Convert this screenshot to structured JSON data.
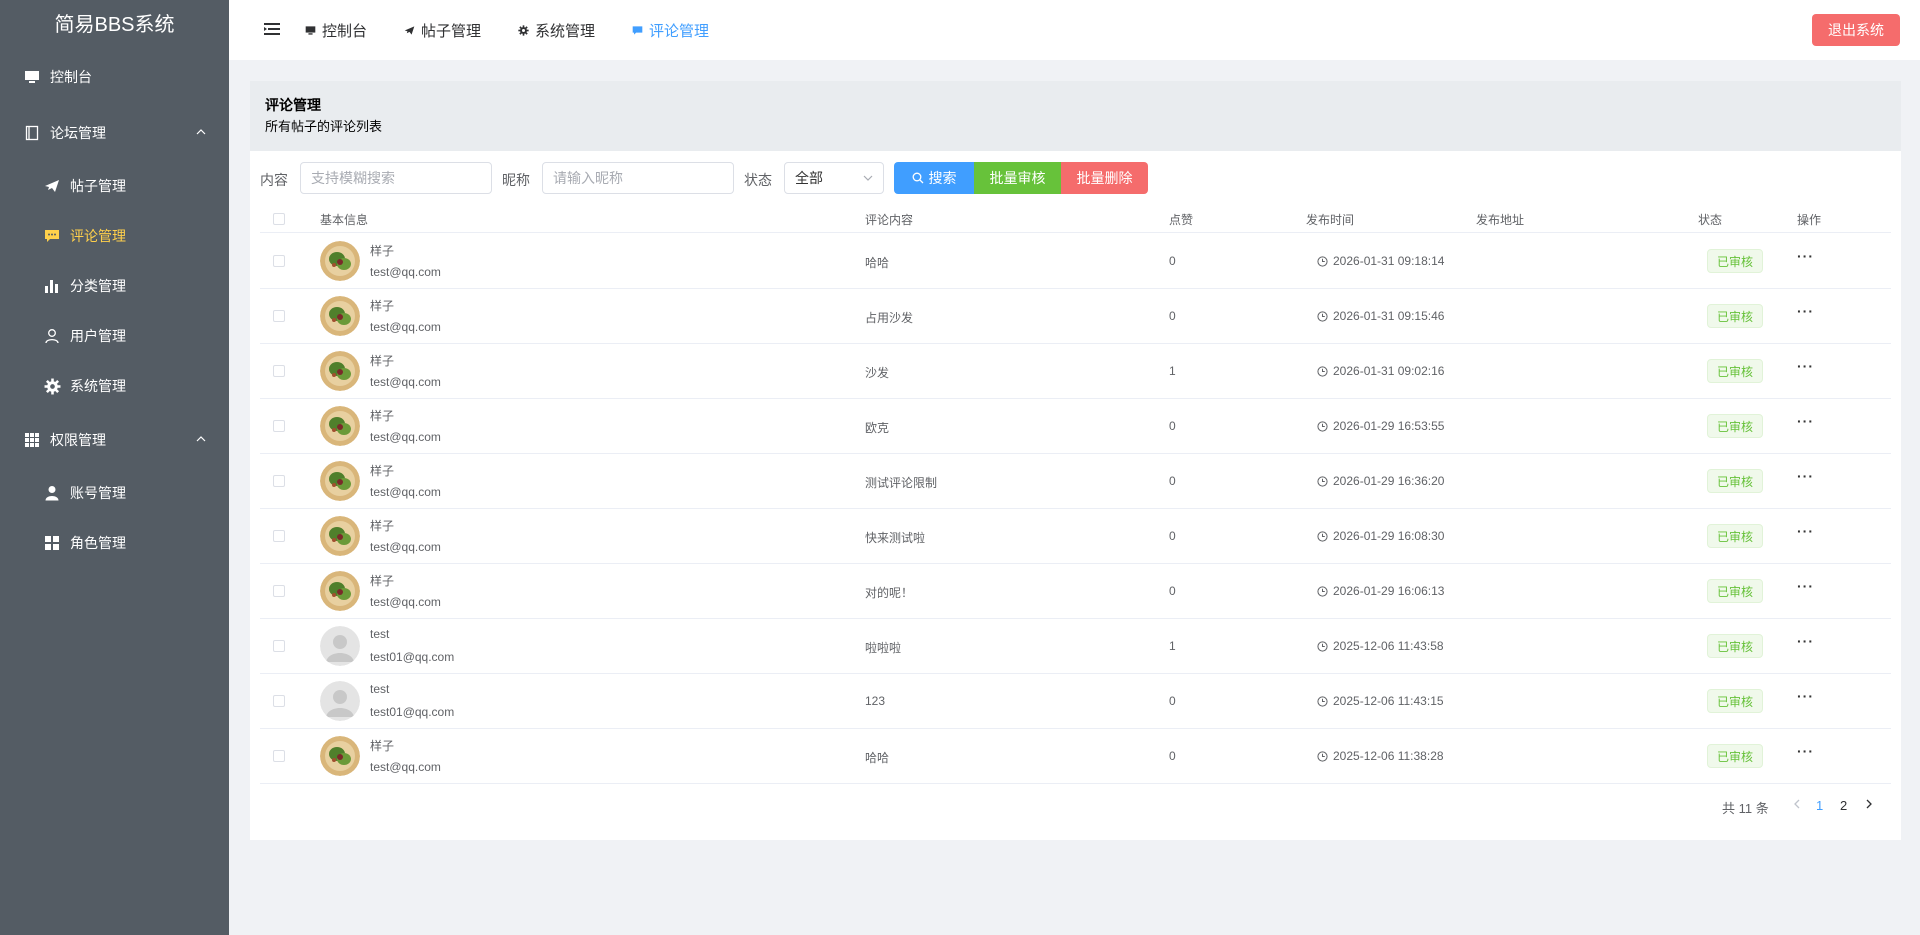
{
  "app": {
    "title": "简易BBS系统"
  },
  "sidebar": {
    "items": [
      {
        "label": "控制台",
        "icon": "monitor-icon"
      },
      {
        "label": "论坛管理",
        "icon": "notebook-icon"
      },
      {
        "label": "帖子管理",
        "icon": "send-icon"
      },
      {
        "label": "评论管理",
        "icon": "chat-icon",
        "active": true
      },
      {
        "label": "分类管理",
        "icon": "bar-chart-icon"
      },
      {
        "label": "用户管理",
        "icon": "user-icon"
      },
      {
        "label": "系统管理",
        "icon": "gear-icon"
      },
      {
        "label": "权限管理",
        "icon": "grid-icon"
      },
      {
        "label": "账号管理",
        "icon": "user-filled-icon"
      },
      {
        "label": "角色管理",
        "icon": "menu-grid-icon"
      }
    ]
  },
  "header": {
    "tabs": [
      {
        "label": "控制台"
      },
      {
        "label": "帖子管理"
      },
      {
        "label": "系统管理"
      },
      {
        "label": "评论管理",
        "active": true
      }
    ],
    "logout_label": "退出系统"
  },
  "card": {
    "title": "评论管理",
    "subtitle": "所有帖子的评论列表"
  },
  "filters": {
    "content_label": "内容",
    "content_placeholder": "支持模糊搜索",
    "nickname_label": "昵称",
    "nickname_placeholder": "请输入昵称",
    "status_label": "状态",
    "status_value": "全部",
    "search_label": "搜索",
    "batch_audit_label": "批量审核",
    "batch_delete_label": "批量删除"
  },
  "table": {
    "headers": {
      "basic": "基本信息",
      "content": "评论内容",
      "likes": "点赞",
      "time": "发布时间",
      "address": "发布地址",
      "status": "状态",
      "actions": "操作"
    },
    "rows": [
      {
        "name": "样子",
        "email": "test@qq.com",
        "avatar": "food",
        "content": "哈哈",
        "likes": "0",
        "time": "2026-01-31 09:18:14",
        "status": "已审核"
      },
      {
        "name": "样子",
        "email": "test@qq.com",
        "avatar": "food",
        "content": "占用沙发",
        "likes": "0",
        "time": "2026-01-31 09:15:46",
        "status": "已审核"
      },
      {
        "name": "样子",
        "email": "test@qq.com",
        "avatar": "food",
        "content": "沙发",
        "likes": "1",
        "time": "2026-01-31 09:02:16",
        "status": "已审核"
      },
      {
        "name": "样子",
        "email": "test@qq.com",
        "avatar": "food",
        "content": "欧克",
        "likes": "0",
        "time": "2026-01-29 16:53:55",
        "status": "已审核"
      },
      {
        "name": "样子",
        "email": "test@qq.com",
        "avatar": "food",
        "content": "测试评论限制",
        "likes": "0",
        "time": "2026-01-29 16:36:20",
        "status": "已审核"
      },
      {
        "name": "样子",
        "email": "test@qq.com",
        "avatar": "food",
        "content": "快来测试啦",
        "likes": "0",
        "time": "2026-01-29 16:08:30",
        "status": "已审核"
      },
      {
        "name": "样子",
        "email": "test@qq.com",
        "avatar": "food",
        "content": "对的呢！",
        "likes": "0",
        "time": "2026-01-29 16:06:13",
        "status": "已审核"
      },
      {
        "name": "test",
        "email": "test01@qq.com",
        "avatar": "default",
        "content": "啦啦啦",
        "likes": "1",
        "time": "2025-12-06 11:43:58",
        "status": "已审核"
      },
      {
        "name": "test",
        "email": "test01@qq.com",
        "avatar": "default",
        "content": "123",
        "likes": "0",
        "time": "2025-12-06 11:43:15",
        "status": "已审核"
      },
      {
        "name": "样子",
        "email": "test@qq.com",
        "avatar": "food",
        "content": "哈哈",
        "likes": "0",
        "time": "2025-12-06 11:38:28",
        "status": "已审核"
      }
    ]
  },
  "pagination": {
    "total": "共 11 条",
    "pages": [
      "1",
      "2"
    ],
    "current": "1"
  },
  "colors": {
    "sidebar_bg": "#545c64",
    "active_menu": "#ffd04b",
    "primary": "#409eff",
    "success": "#67c23a",
    "danger": "#f56c6c"
  }
}
